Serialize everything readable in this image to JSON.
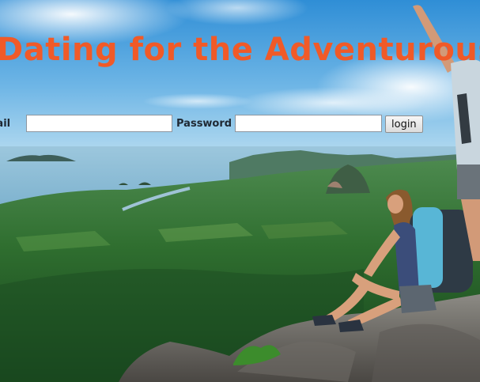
{
  "page": {
    "headline": "Dating for the Adventurous",
    "accent_color": "#f05a28"
  },
  "login": {
    "email_label": "Email",
    "email_value": "",
    "email_placeholder": "",
    "password_label": "Password",
    "password_value": "",
    "password_placeholder": "",
    "button_label": "login"
  },
  "background": {
    "subject": "hikers-on-cliff-overlooking-valley"
  }
}
